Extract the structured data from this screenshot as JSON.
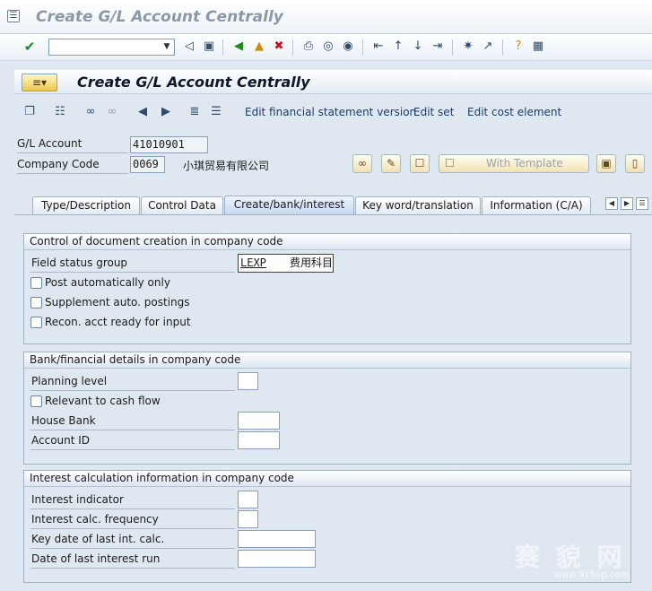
{
  "window": {
    "title": "Create G/L Account Centrally",
    "system_icon": "sys-menu-icon"
  },
  "std_toolbar": {
    "command_field_value": "",
    "icons": [
      "enter-icon",
      "save-icon",
      "back-icon",
      "exit-icon",
      "cancel-icon",
      "print-icon",
      "find-icon",
      "find-next-icon",
      "first-page-icon",
      "previous-page-icon",
      "next-page-icon",
      "last-page-icon",
      "new-session-icon",
      "shortcut-icon",
      "help-icon",
      "customize-layout-icon"
    ]
  },
  "app": {
    "title": "Create G/L Account Centrally",
    "menu_button": "menu-icon",
    "links": {
      "edit_fs_version": "Edit financial statement version",
      "edit_set": "Edit set",
      "edit_cost_element": "Edit cost element"
    }
  },
  "header": {
    "gl_account_label": "G/L Account",
    "gl_account_value": "41010901",
    "company_code_label": "Company Code",
    "company_code_value": "0069",
    "company_name": "小琪贸易有限公司",
    "with_template_label": "With Template"
  },
  "tabs": [
    {
      "label": "Type/Description",
      "active": false
    },
    {
      "label": "Control Data",
      "active": false
    },
    {
      "label": "Create/bank/interest",
      "active": true
    },
    {
      "label": "Key word/translation",
      "active": false
    },
    {
      "label": "Information (C/A)",
      "active": false
    }
  ],
  "groups": {
    "doc_creation": {
      "title": "Control of document creation in company code",
      "field_status_group_label": "Field status group",
      "field_status_group_value": "LEXP",
      "field_status_group_text": "费用科目",
      "post_auto_label": "Post automatically only",
      "post_auto_checked": false,
      "supplement_label": "Supplement auto. postings",
      "supplement_checked": false,
      "recon_label": "Recon. acct ready for input",
      "recon_checked": false
    },
    "bank": {
      "title": "Bank/financial details in company code",
      "planning_level_label": "Planning level",
      "planning_level_value": "",
      "cash_flow_label": "Relevant to cash flow",
      "cash_flow_checked": false,
      "house_bank_label": "House Bank",
      "house_bank_value": "",
      "account_id_label": "Account ID",
      "account_id_value": ""
    },
    "interest": {
      "title": "Interest calculation information in company code",
      "indicator_label": "Interest indicator",
      "indicator_value": "",
      "frequency_label": "Interest calc. frequency",
      "frequency_value": "",
      "key_date_label": "Key date of last int. calc.",
      "key_date_value": "",
      "last_run_label": "Date of last interest run",
      "last_run_value": ""
    }
  },
  "watermark": {
    "text": "赛 貌 网",
    "url": "www.915ap.com"
  },
  "colors": {
    "background": "#dfe8f1",
    "highlight_border": "#d0021b",
    "link": "#1c3b66"
  }
}
